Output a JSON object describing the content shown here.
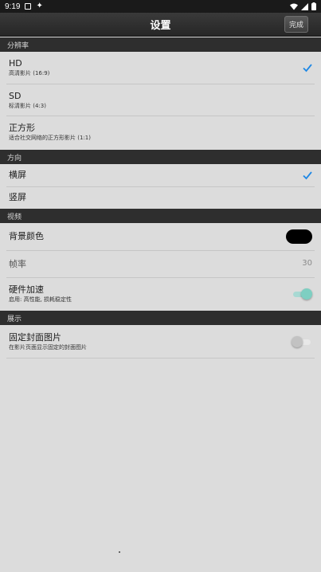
{
  "status_bar": {
    "time": "9:19",
    "icons_left": [
      "square-icon",
      "bug-icon"
    ],
    "icons_right": [
      "wifi-icon",
      "signal-icon",
      "battery-icon"
    ]
  },
  "nav": {
    "title": "设置",
    "done_label": "完成"
  },
  "sections": {
    "resolution": {
      "header": "分辨率",
      "items": [
        {
          "title": "HD",
          "subtitle": "高清影片 (16:9)",
          "checked": true
        },
        {
          "title": "SD",
          "subtitle": "标清影片 (4:3)",
          "checked": false
        },
        {
          "title": "正方形",
          "subtitle": "适合社交网络的正方形影片 (1:1)",
          "checked": false
        }
      ]
    },
    "orientation": {
      "header": "方向",
      "items": [
        {
          "title": "横屏",
          "checked": true
        },
        {
          "title": "竖屏",
          "checked": false
        }
      ]
    },
    "video": {
      "header": "视频",
      "background_color": {
        "title": "背景颜色",
        "color": "#000000"
      },
      "frame_rate": {
        "title": "帧率",
        "value": "30"
      },
      "hardware_accel": {
        "title": "硬件加速",
        "subtitle": "启用: 高性能, 损耗稳定性",
        "enabled": true
      }
    },
    "display": {
      "header": "展示",
      "fixed_cover": {
        "title": "固定封面图片",
        "subtitle": "在影片页面显示固定的封面图片",
        "enabled": false
      }
    }
  },
  "colors": {
    "accent_check": "#1e88e5",
    "toggle_on": "#7ecfc2",
    "section_bg": "#2e2e2e",
    "page_bg": "#dcdcdc"
  }
}
